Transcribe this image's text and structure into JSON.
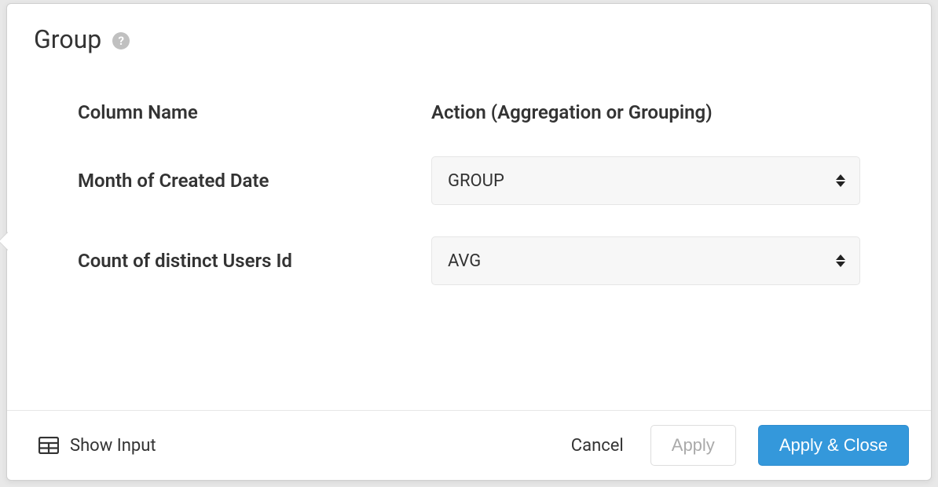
{
  "dialog": {
    "title": "Group"
  },
  "table": {
    "headers": {
      "column_name": "Column Name",
      "action": "Action (Aggregation or Grouping)"
    },
    "rows": [
      {
        "name": "Month of Created Date",
        "action": "GROUP"
      },
      {
        "name": "Count of distinct Users Id",
        "action": "AVG"
      }
    ]
  },
  "footer": {
    "show_input": "Show Input",
    "cancel": "Cancel",
    "apply": "Apply",
    "apply_close": "Apply & Close"
  }
}
